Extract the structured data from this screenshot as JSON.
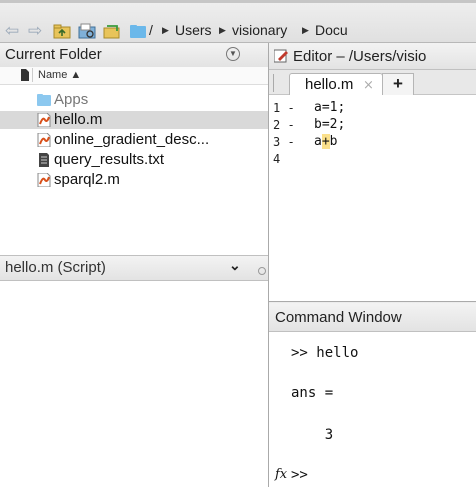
{
  "toolbar": {
    "breadcrumb": [
      "/",
      "Users",
      "visionary",
      "Docu"
    ]
  },
  "current_folder": {
    "title": "Current Folder",
    "column_name": "Name ▲",
    "items": [
      {
        "name": "Apps",
        "icon": "folder-icon"
      },
      {
        "name": "hello.m",
        "icon": "matlab-script-icon"
      },
      {
        "name": "online_gradient_desc...",
        "icon": "matlab-script-icon"
      },
      {
        "name": "query_results.txt",
        "icon": "text-file-icon"
      },
      {
        "name": "sparql2.m",
        "icon": "matlab-script-icon"
      }
    ]
  },
  "details": {
    "title": "hello.m  (Script)"
  },
  "editor": {
    "title": "Editor – /Users/visio",
    "tab_label": "hello.m",
    "tab_close": "⨯",
    "tab_add": "+",
    "lines": [
      {
        "number": "1",
        "marker": "-",
        "code_before": "a=1;",
        "code_hl": "",
        "code_after": ""
      },
      {
        "number": "2",
        "marker": "-",
        "code_before": "b=2;",
        "code_hl": "",
        "code_after": ""
      },
      {
        "number": "3",
        "marker": "-",
        "code_before": "a",
        "code_hl": "+",
        "code_after": "b"
      },
      {
        "number": "4",
        "marker": "",
        "code_before": "",
        "code_hl": "",
        "code_after": ""
      }
    ]
  },
  "command_window": {
    "title": "Command Window",
    "line1": ">> hello",
    "line2": "ans =",
    "line3": "    3",
    "fx": "fx",
    "prompt": ">>"
  },
  "colors": {
    "accent": "#4fa3e0",
    "highlight": "#fbe08b",
    "selected_row": "#d9d9d9"
  }
}
